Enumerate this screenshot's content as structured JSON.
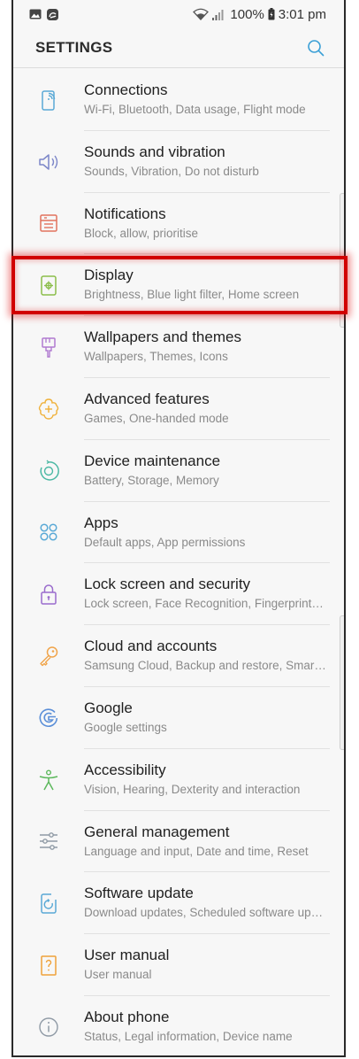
{
  "status": {
    "battery": "100%",
    "time": "3:01 pm"
  },
  "header": {
    "title": "SETTINGS"
  },
  "items": [
    {
      "key": "connections",
      "icon": "connections-icon",
      "title": "Connections",
      "subtitle": "Wi-Fi, Bluetooth, Data usage, Flight mode",
      "color": "#5aa9d6"
    },
    {
      "key": "sounds",
      "icon": "speaker-icon",
      "title": "Sounds and vibration",
      "subtitle": "Sounds, Vibration, Do not disturb",
      "color": "#7c86c8"
    },
    {
      "key": "notifications",
      "icon": "notifications-icon",
      "title": "Notifications",
      "subtitle": "Block, allow, prioritise",
      "color": "#e2735f"
    },
    {
      "key": "display",
      "icon": "display-icon",
      "title": "Display",
      "subtitle": "Brightness, Blue light filter, Home screen",
      "color": "#8bbd4a"
    },
    {
      "key": "wallpapers",
      "icon": "brush-icon",
      "title": "Wallpapers and themes",
      "subtitle": "Wallpapers, Themes, Icons",
      "color": "#b07ad0"
    },
    {
      "key": "advanced",
      "icon": "advanced-features-icon",
      "title": "Advanced features",
      "subtitle": "Games, One-handed mode",
      "color": "#efb13a"
    },
    {
      "key": "maintenance",
      "icon": "device-maintenance-icon",
      "title": "Device maintenance",
      "subtitle": "Battery, Storage, Memory",
      "color": "#4bb8a4"
    },
    {
      "key": "apps",
      "icon": "apps-icon",
      "title": "Apps",
      "subtitle": "Default apps, App permissions",
      "color": "#5aa9d6"
    },
    {
      "key": "lock",
      "icon": "lock-icon",
      "title": "Lock screen and security",
      "subtitle": "Lock screen, Face Recognition, Fingerprints…",
      "color": "#9a6ccd"
    },
    {
      "key": "cloud",
      "icon": "key-icon",
      "title": "Cloud and accounts",
      "subtitle": "Samsung Cloud, Backup and restore, Smart…",
      "color": "#f0a44a"
    },
    {
      "key": "google",
      "icon": "google-icon",
      "title": "Google",
      "subtitle": "Google settings",
      "color": "#5b8fd8"
    },
    {
      "key": "accessibility",
      "icon": "accessibility-icon",
      "title": "Accessibility",
      "subtitle": "Vision, Hearing, Dexterity and interaction",
      "color": "#5cb85c"
    },
    {
      "key": "general",
      "icon": "sliders-icon",
      "title": "General management",
      "subtitle": "Language and input, Date and time, Reset",
      "color": "#8f9aa5"
    },
    {
      "key": "update",
      "icon": "software-update-icon",
      "title": "Software update",
      "subtitle": "Download updates, Scheduled software up…",
      "color": "#5aa9d6"
    },
    {
      "key": "manual",
      "icon": "user-manual-icon",
      "title": "User manual",
      "subtitle": "User manual",
      "color": "#efa23a"
    },
    {
      "key": "about",
      "icon": "info-icon",
      "title": "About phone",
      "subtitle": "Status, Legal information, Device name",
      "color": "#8f9aa5"
    }
  ]
}
